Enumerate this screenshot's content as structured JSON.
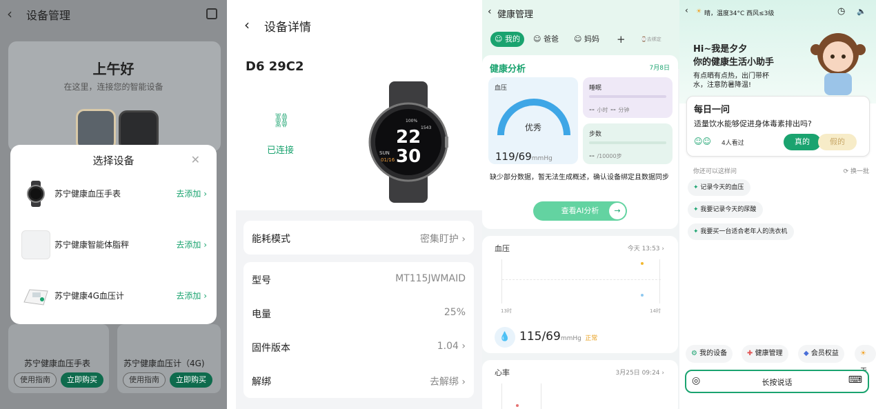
{
  "device_mgmt": {
    "title": "设备管理",
    "greeting": "上午好",
    "subtitle": "在这里，连接您的智能设备",
    "products": [
      {
        "name": "苏宁健康血压手表",
        "guide": "使用指南",
        "buy": "立即购买"
      },
      {
        "name": "苏宁健康血压计（4G)",
        "guide": "使用指南",
        "buy": "立即购买"
      }
    ],
    "modal": {
      "title": "选择设备",
      "add_label": "去添加",
      "items": [
        {
          "label": "苏宁健康血压手表"
        },
        {
          "label": "苏宁健康智能体脂秤"
        },
        {
          "label": "苏宁健康4G血压计"
        }
      ]
    }
  },
  "device_detail": {
    "title": "设备详情",
    "device_name": "D6 29C2",
    "status": "已连接",
    "watch_face": {
      "time_top": "22",
      "time_bottom": "30",
      "day": "SUN",
      "date": "01/16",
      "top": "100%",
      "right": "1543"
    },
    "rows": [
      {
        "label": "能耗模式",
        "value": "密集盯护",
        "chevron": true
      },
      {
        "label": "型号",
        "value": "MT115JWMAID",
        "chevron": false
      },
      {
        "label": "电量",
        "value": "25%",
        "chevron": false
      },
      {
        "label": "固件版本",
        "value": "1.04",
        "chevron": true
      },
      {
        "label": "解绑",
        "value": "去解绑",
        "chevron": true
      }
    ]
  },
  "health_mgmt": {
    "title": "健康管理",
    "tabs": [
      {
        "label": "我的"
      },
      {
        "label": "爸爸"
      },
      {
        "label": "妈妈"
      },
      {
        "label": "+"
      },
      {
        "label": "去绑定"
      }
    ],
    "analysis": {
      "title": "健康分析",
      "date": "7月8日",
      "bp_label": "血压",
      "bp_rating": "优秀",
      "bp_value": "119/69",
      "bp_unit": "mmHg",
      "sleep_label": "睡眠",
      "sleep_hours": "-- ",
      "sleep_hours_unit": "小时",
      "sleep_min": "-- ",
      "sleep_min_unit": "分钟",
      "steps_label": "步数",
      "steps_value": "-- ",
      "steps_unit": "/10000步",
      "notice": "缺少部分数据，暂无法生成概述，确认设备绑定且数据同步",
      "ai_button": "查看AI分析"
    },
    "bp_card": {
      "title": "血压",
      "time": "今天 13:53",
      "x_start": "13时",
      "x_end": "14时",
      "value": "115/69",
      "unit": "mmHg",
      "status": "正常"
    },
    "hr_card": {
      "title": "心率",
      "time": "3月25日 09:24"
    }
  },
  "assistant": {
    "weather": "晴，温度34°C 西风≤3级",
    "hi_line1": "Hi~我是夕夕",
    "hi_line2": "你的健康生活小助手",
    "tip": "有点晒有点热，出门带杯水，注意防暑降温!",
    "question_title": "每日一问",
    "question": "适量饮水能够促进身体毒素排出吗?",
    "viewers": "4人看过",
    "true_btn": "真的",
    "false_btn": "假的",
    "suggest_title": "你还可以这样问",
    "refresh": "换一批",
    "suggestions": [
      "记录今天的血压",
      "我要记录今天的尿酸",
      "我要买一台适合老年人的洗衣机"
    ],
    "shortcuts": [
      {
        "label": "我的设备"
      },
      {
        "label": "健康管理"
      },
      {
        "label": "会员权益"
      },
      {
        "label": "天"
      }
    ],
    "voice": "长按说话"
  },
  "colors": {
    "accent": "#1aa36f",
    "dark_green": "#0f6b4d",
    "bp_blue": "#3ea6e6"
  }
}
